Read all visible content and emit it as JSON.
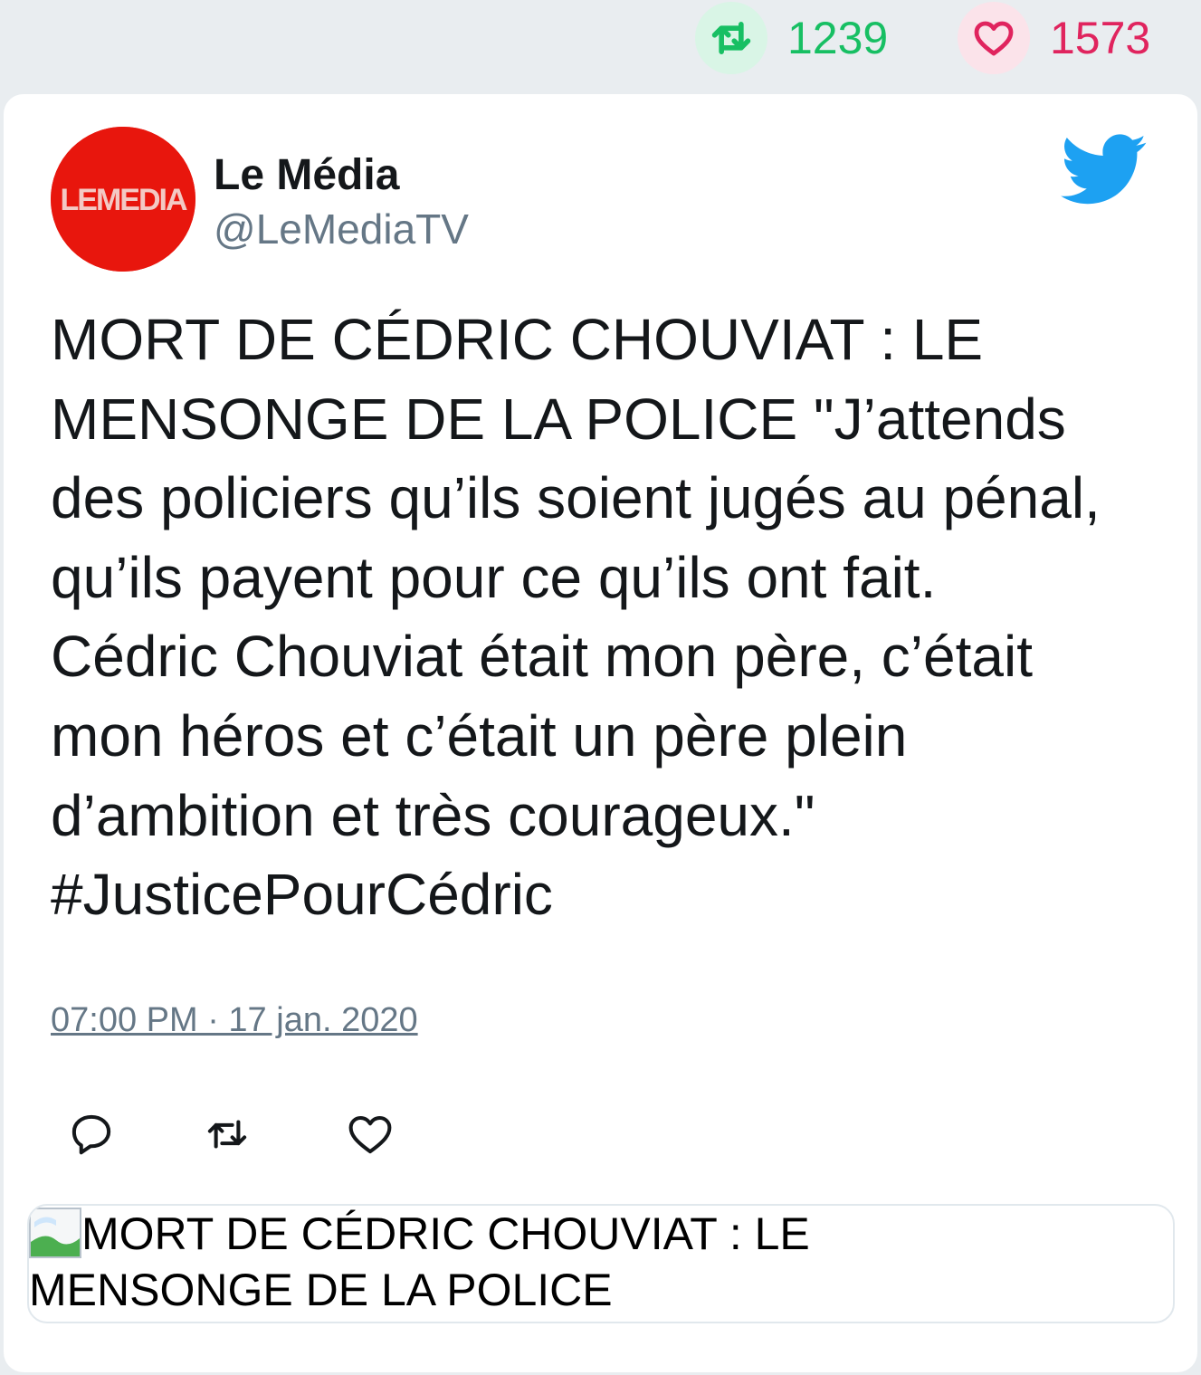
{
  "stats": {
    "retweets": "1239",
    "likes": "1573",
    "retweet_color": "#17bf63",
    "like_color": "#e0245e"
  },
  "author": {
    "avatar_text": "LEMEDIA",
    "avatar_color": "#e8160d",
    "name": "Le Média",
    "handle": "@LeMediaTV"
  },
  "tweet": {
    "lines": [
      "MORT DE CÉDRIC CHOUVIAT : LE",
      "MENSONGE DE LA POLICE \"J’attends",
      "des policiers qu’ils soient jugés au pénal,",
      "qu’ils payent pour ce qu’ils ont fait.",
      "Cédric Chouviat était mon père, c’était",
      "mon héros et c’était un père plein",
      "d’ambition et très courageux.\"",
      "#JusticePourCédric"
    ],
    "timestamp": "07:00 PM · 17 jan. 2020"
  },
  "actions": {
    "reply_icon": "reply-icon",
    "retweet_icon": "retweet-icon",
    "like_icon": "heart-icon"
  },
  "link_card": {
    "title_line1": "MORT DE CÉDRIC CHOUVIAT : LE",
    "title_line2": "MENSONGE DE LA POLICE"
  },
  "brand_color": "#1da1f2"
}
